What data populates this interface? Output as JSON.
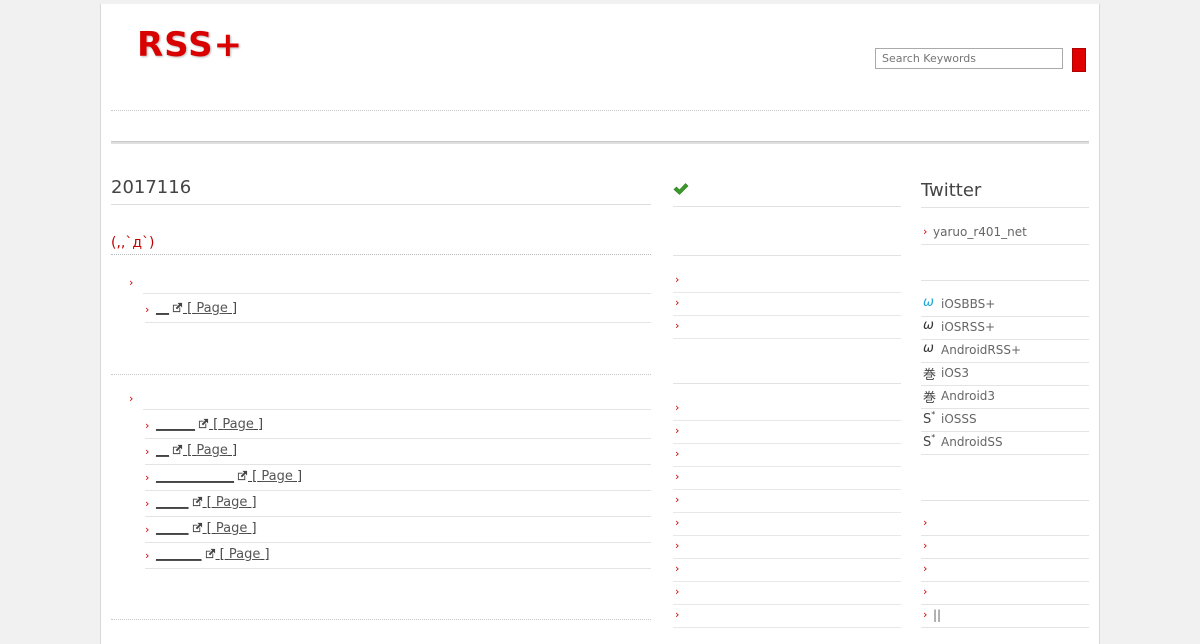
{
  "header": {
    "logo_text": "RSS+",
    "search_placeholder": "Search Keywords"
  },
  "post": {
    "date": "2017116",
    "title": "(,,`д`)"
  },
  "sections": [
    {
      "entries": [
        {
          "link_text": "__",
          "page_label": "Page"
        }
      ]
    },
    {
      "entries": [
        {
          "link_text": "______",
          "page_label": "Page"
        },
        {
          "link_text": "__",
          "page_label": "Page"
        },
        {
          "link_text": "____________",
          "page_label": "Page"
        },
        {
          "link_text": "_____",
          "page_label": "Page"
        },
        {
          "link_text": "_____",
          "page_label": "Page"
        },
        {
          "link_text": "_______",
          "page_label": "Page"
        }
      ]
    }
  ],
  "bracket_open": "[",
  "bracket_close": "]",
  "sidebar": {
    "twitter_title": "Twitter",
    "twitter_account": "yaruo_r401_net",
    "apps": [
      {
        "glyph": "ω",
        "label": "iOSBBS+"
      },
      {
        "glyph": "ω",
        "label": "iOSRSS+"
      },
      {
        "glyph": "ω",
        "label": "AndroidRSS+"
      },
      {
        "glyph": "巻",
        "label": "iOS3"
      },
      {
        "glyph": "巻",
        "label": "Android3"
      },
      {
        "glyph": "S",
        "label": "iOSSS"
      },
      {
        "glyph": "S",
        "label": "AndroidSS"
      }
    ],
    "last_item_label": "||",
    "sup_mark": "*"
  },
  "icons": {
    "arrow": "chevron-right-icon",
    "check": "check-icon",
    "external": "external-link-icon"
  },
  "colors": {
    "brand_red": "#d90000",
    "check_green": "#3a9a2a",
    "app_blue": "#1fa7d8"
  }
}
